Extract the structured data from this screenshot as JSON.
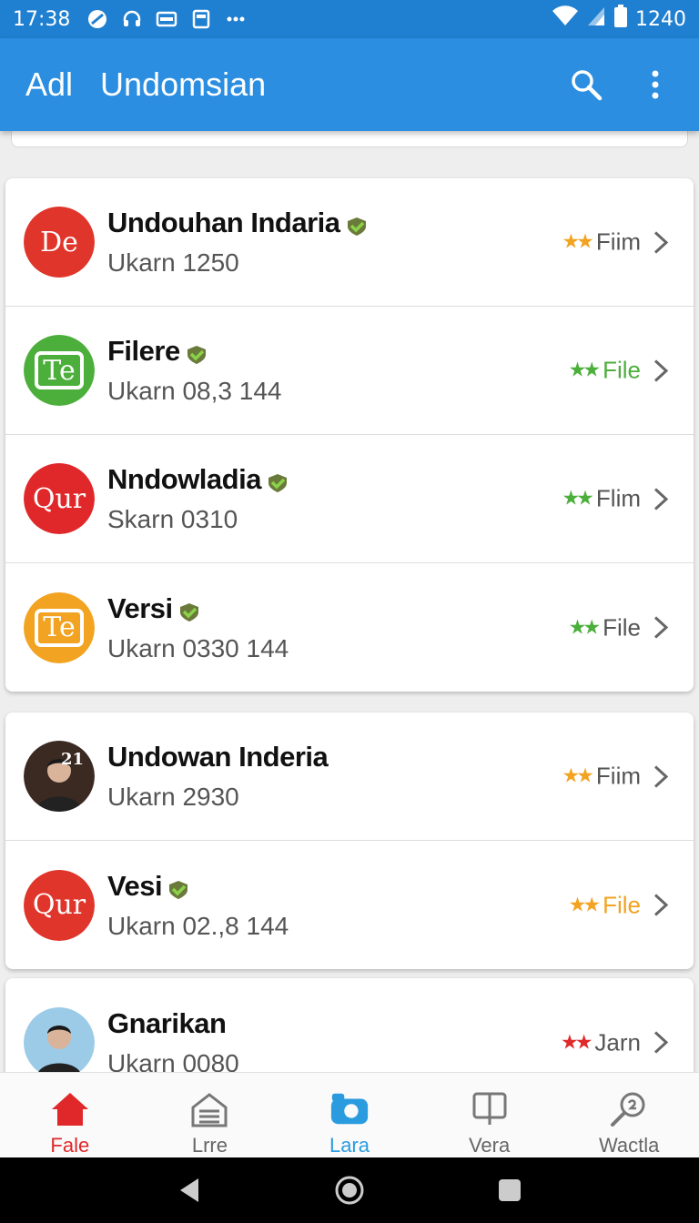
{
  "status_bar": {
    "time": "17:38",
    "right_text": "1240"
  },
  "app_bar": {
    "title_left": "Adl",
    "title_main": "Undomsian"
  },
  "colors": {
    "primary": "#2b8ee0",
    "statusbar": "#1f7fd0",
    "star_orange": "#f2a322",
    "star_green": "#4caf3c",
    "star_red": "#e02a2a",
    "tag_green": "#4caf3c",
    "tag_orange": "#f2a322"
  },
  "group1": [
    {
      "title": "Undouhan Indaria",
      "subtitle": "Ukarn 1250",
      "tag": "Fiim",
      "stars": "★★",
      "star_color": "orange",
      "tag_color": "gray",
      "avatar": {
        "type": "logo",
        "text": "De",
        "bg": "#e0352b"
      },
      "verified": true
    },
    {
      "title": "Filere",
      "subtitle": "Ukarn 08,3 144",
      "tag": "File",
      "stars": "★★",
      "star_color": "green",
      "tag_color": "green",
      "avatar": {
        "type": "logo",
        "text": "Te",
        "bg": "#4caf3c"
      },
      "verified": true
    },
    {
      "title": "Nndowladia",
      "subtitle": "Skarn 0310",
      "tag": "Flim",
      "stars": "★★",
      "star_color": "green",
      "tag_color": "gray",
      "avatar": {
        "type": "logo",
        "text": "Qur",
        "bg": "#e0282a"
      },
      "verified": true
    },
    {
      "title": "Versi",
      "subtitle": "Ukarn 0330 144",
      "tag": "File",
      "stars": "★★",
      "star_color": "green",
      "tag_color": "gray",
      "avatar": {
        "type": "logo",
        "text": "Te",
        "bg": "#f2a322"
      },
      "verified": true
    }
  ],
  "group2": [
    {
      "title": "Undowan Inderia",
      "subtitle": "Ukarn 2930",
      "tag": "Fiim",
      "stars": "★★",
      "star_color": "orange",
      "tag_color": "gray",
      "avatar": {
        "type": "photo",
        "text": "21",
        "bg": "#3b2a22"
      },
      "verified": false
    },
    {
      "title": "Vesi",
      "subtitle": "Ukarn 02.,8 144",
      "tag": "File",
      "stars": "★★",
      "star_color": "orange",
      "tag_color": "orange",
      "avatar": {
        "type": "logo",
        "text": "Qur",
        "bg": "#e0352b"
      },
      "verified": true
    }
  ],
  "group3": [
    {
      "title": "Gnarikan",
      "subtitle": "Ukarn 0080",
      "tag": "Jarn",
      "stars": "★★",
      "star_color": "red",
      "tag_color": "gray",
      "avatar": {
        "type": "photo",
        "text": "",
        "bg": "#9ccbe8"
      },
      "verified": false
    }
  ],
  "bottom_nav": [
    {
      "label": "Fale",
      "icon": "home-icon"
    },
    {
      "label": "Lrre",
      "icon": "inbox-icon"
    },
    {
      "label": "Lara",
      "icon": "camera-icon"
    },
    {
      "label": "Vera",
      "icon": "chat-icon"
    },
    {
      "label": "Wactla",
      "icon": "search-key-icon"
    }
  ]
}
